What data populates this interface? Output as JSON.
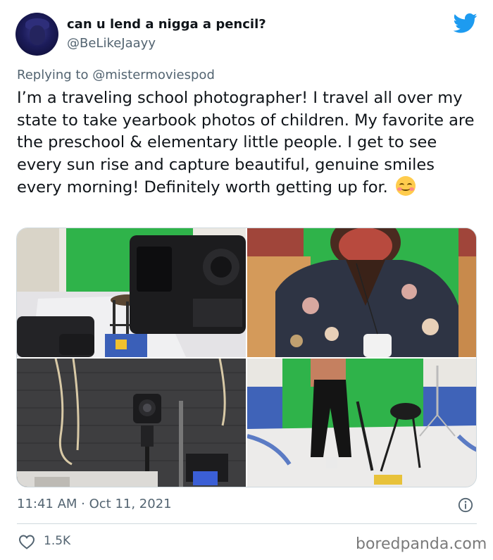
{
  "author": {
    "display_name": "can u lend a nigga a pencil?",
    "handle": "@BeLikeJaayy"
  },
  "reply": {
    "prefix": "Replying to",
    "mention": "@mistermoviespod"
  },
  "tweet": {
    "text": "I’m a traveling school photographer! I travel all over my state to take yearbook photos of children. My favorite are the preschool & elementary little people. I get to see every sun rise and capture beautiful, genuine smiles every morning! Definitely worth getting up for.",
    "emoji": "smiling-face-with-blush-emoji"
  },
  "meta": {
    "timestamp": "11:41 AM · Oct 11, 2021",
    "likes": "1.5K"
  },
  "watermark": "boredpanda.com",
  "colors": {
    "twitter_blue": "#1d9bf0",
    "secondary_text": "#536471",
    "green_screen": "#2fb34a"
  }
}
